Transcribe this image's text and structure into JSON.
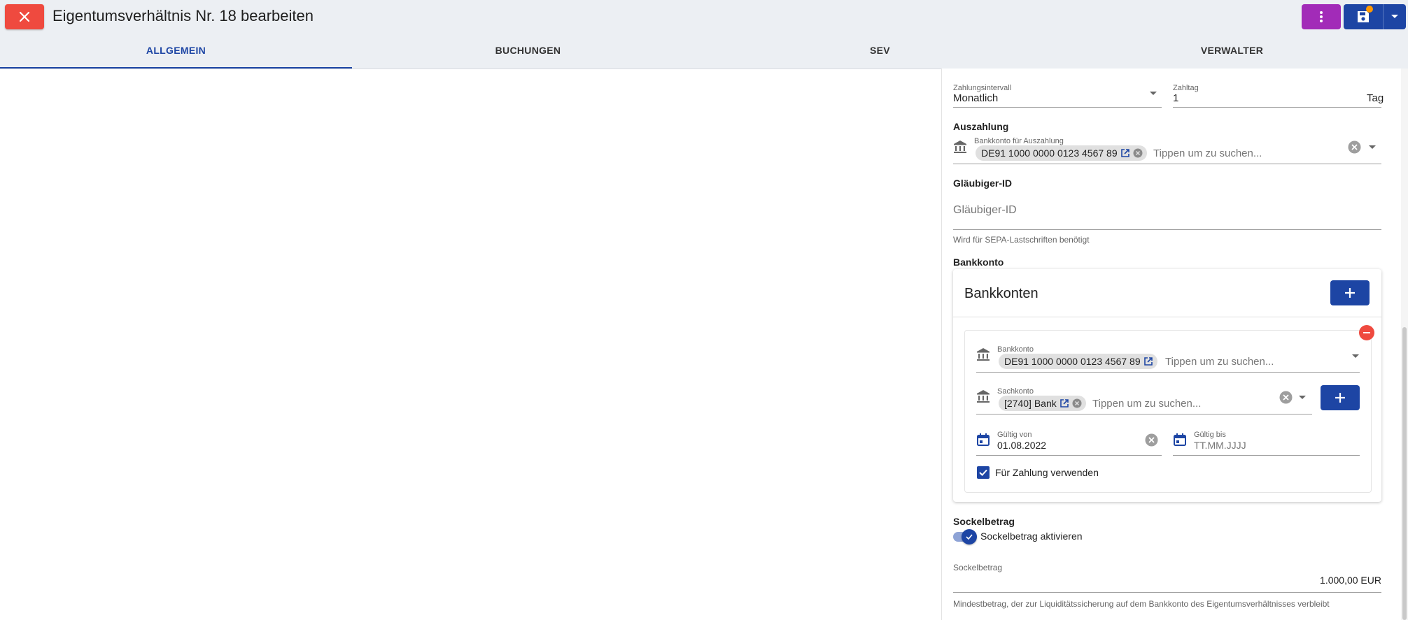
{
  "header": {
    "title": "Eigentumsverhältnis Nr. 18 bearbeiten",
    "close_icon": "close-icon",
    "menu_icon": "more-vert-icon",
    "save_icon": "save-icon",
    "dropdown_icon": "arrow-drop-down-icon",
    "accent_color": "#1d45a4",
    "close_color": "#ef4a3f",
    "menu_color": "#a22bb8"
  },
  "tabs": [
    {
      "label": "ALLGEMEIN",
      "active": true
    },
    {
      "label": "BUCHUNGEN",
      "active": false
    },
    {
      "label": "SEV",
      "active": false
    },
    {
      "label": "VERWALTER",
      "active": false
    }
  ],
  "form": {
    "zahlungsintervall": {
      "label": "Zahlungsintervall",
      "value": "Monatlich"
    },
    "zahltag": {
      "label": "Zahltag",
      "value": "1",
      "suffix": "Tag"
    },
    "auszahlung": {
      "heading": "Auszahlung",
      "field_label": "Bankkonto für Auszahlung",
      "chip": "DE91 1000 0000 0123 4567 89",
      "placeholder": "Tippen um zu suchen..."
    },
    "glaeubiger": {
      "heading": "Gläubiger-ID",
      "placeholder": "Gläubiger-ID",
      "hint": "Wird für SEPA-Lastschriften benötigt"
    },
    "bankkonto_heading": "Bankkonto",
    "bankkonten": {
      "title": "Bankkonten",
      "entry": {
        "bankkonto_label": "Bankkonto",
        "bankkonto_chip": "DE91 1000 0000 0123 4567 89",
        "bankkonto_placeholder": "Tippen um zu suchen...",
        "sachkonto_label": "Sachkonto",
        "sachkonto_chip": "[2740] Bank",
        "sachkonto_placeholder": "Tippen um zu suchen...",
        "gueltig_von_label": "Gültig von",
        "gueltig_von_value": "01.08.2022",
        "gueltig_bis_label": "Gültig bis",
        "gueltig_bis_placeholder": "TT.MM.JJJJ",
        "checkbox_label": "Für Zahlung verwenden",
        "checkbox_checked": true
      }
    },
    "sockelbetrag": {
      "heading": "Sockelbetrag",
      "toggle_label": "Sockelbetrag aktivieren",
      "toggle_on": true,
      "field_label": "Sockelbetrag",
      "value": "1.000,00 EUR",
      "hint": "Mindestbetrag, der zur Liquiditätssicherung auf dem Bankkonto des Eigentumsverhältnisses verbleibt"
    }
  }
}
